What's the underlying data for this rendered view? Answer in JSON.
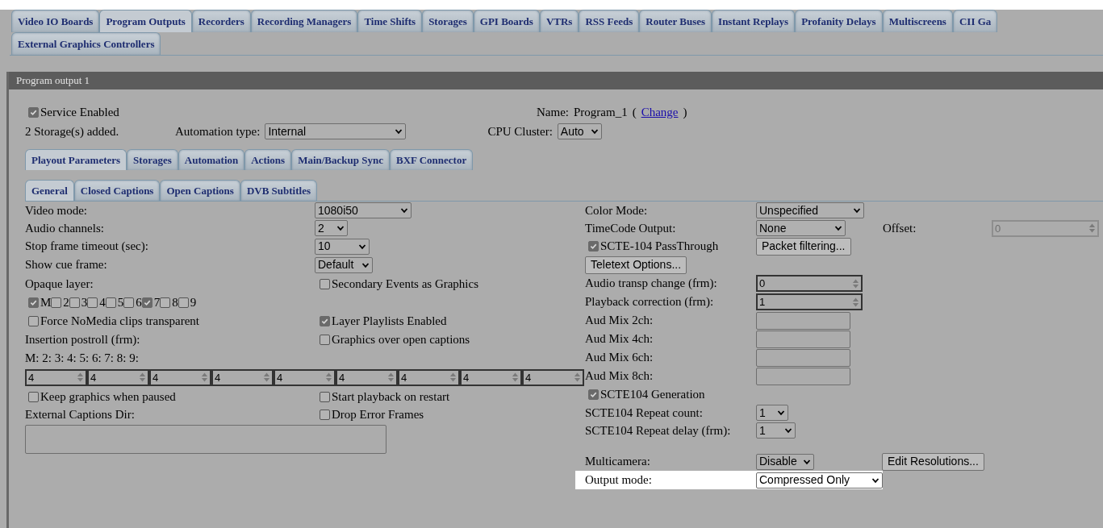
{
  "main_tabs": [
    {
      "label": "Video IO Boards",
      "selected": false
    },
    {
      "label": "Program Outputs",
      "selected": true
    },
    {
      "label": "Recorders",
      "selected": false
    },
    {
      "label": "Recording Managers",
      "selected": false
    },
    {
      "label": "Time Shifts",
      "selected": false
    },
    {
      "label": "Storages",
      "selected": false
    },
    {
      "label": "GPI Boards",
      "selected": false
    },
    {
      "label": "VTRs",
      "selected": false
    },
    {
      "label": "RSS Feeds",
      "selected": false
    },
    {
      "label": "Router Buses",
      "selected": false
    },
    {
      "label": "Instant Replays",
      "selected": false
    },
    {
      "label": "Profanity Delays",
      "selected": false
    },
    {
      "label": "Multiscreens",
      "selected": false
    },
    {
      "label": "CII Ga",
      "selected": false
    },
    {
      "label": "External Graphics Controllers",
      "selected": false
    }
  ],
  "panel": {
    "title": "Program output 1",
    "service_enabled": {
      "label": "Service Enabled",
      "checked": true
    },
    "storage_info": "2 Storage(s) added.",
    "automation_type": {
      "label": "Automation type:",
      "value": "Internal"
    },
    "name": {
      "label": "Name:",
      "value": "Program_1",
      "open": "(",
      "link": "Change",
      "close": ")"
    },
    "cpu_cluster": {
      "label": "CPU Cluster:",
      "value": "Auto"
    },
    "section_tabs": [
      {
        "label": "Playout Parameters",
        "selected": true
      },
      {
        "label": "Storages",
        "selected": false
      },
      {
        "label": "Automation",
        "selected": false
      },
      {
        "label": "Actions",
        "selected": false
      },
      {
        "label": "Main/Backup Sync",
        "selected": false
      },
      {
        "label": "BXF Connector",
        "selected": false
      }
    ],
    "sub_tabs": [
      {
        "label": "General",
        "selected": true
      },
      {
        "label": "Closed Captions",
        "selected": false
      },
      {
        "label": "Open Captions",
        "selected": false
      },
      {
        "label": "DVB Subtitles",
        "selected": false
      }
    ],
    "general": {
      "video_mode": {
        "label": "Video mode:",
        "value": "1080i50"
      },
      "audio_channels": {
        "label": "Audio channels:",
        "value": "2"
      },
      "stop_frame_timeout": {
        "label": "Stop frame timeout (sec):",
        "value": "10"
      },
      "show_cue_frame": {
        "label": "Show cue frame:",
        "value": "Default"
      },
      "opaque_layer": {
        "label": "Opaque layer:",
        "layers": [
          {
            "label": "M",
            "checked": true
          },
          {
            "label": "2",
            "checked": false
          },
          {
            "label": "3",
            "checked": false
          },
          {
            "label": "4",
            "checked": false
          },
          {
            "label": "5",
            "checked": false
          },
          {
            "label": "6",
            "checked": false
          },
          {
            "label": "7",
            "checked": true
          },
          {
            "label": "8",
            "checked": false
          },
          {
            "label": "9",
            "checked": false
          }
        ]
      },
      "secondary_events": {
        "label": "Secondary Events as Graphics",
        "checked": false
      },
      "force_nomedia": {
        "label": "Force NoMedia clips transparent",
        "checked": false
      },
      "layer_playlists": {
        "label": "Layer Playlists Enabled",
        "checked": true
      },
      "insertion_postroll": {
        "label": "Insertion postroll (frm):",
        "layer_labels": "M: 2: 3: 4: 5: 6: 7: 8: 9:",
        "values": [
          "4",
          "4",
          "4",
          "4",
          "4",
          "4",
          "4",
          "4",
          "4"
        ]
      },
      "graphics_over_open_captions": {
        "label": "Graphics over open captions",
        "checked": false
      },
      "keep_graphics": {
        "label": "Keep graphics when paused",
        "checked": false
      },
      "start_playback": {
        "label": "Start playback on restart",
        "checked": false
      },
      "external_captions_dir": {
        "label": "External Captions Dir:"
      },
      "drop_error_frames": {
        "label": "Drop Error Frames",
        "checked": false
      }
    },
    "right_rows": [
      {
        "kind": "select",
        "label": "Color Mode:",
        "value": "Unspecified"
      },
      {
        "kind": "select",
        "label": "TimeCode Output:",
        "value": "None",
        "offset": {
          "label": "Offset:",
          "value": "0",
          "disabled": true
        }
      },
      {
        "kind": "checkbox",
        "label": "SCTE-104 PassThrough",
        "checked": true,
        "button": "Packet filtering..."
      },
      {
        "kind": "button",
        "label": "Teletext Options..."
      },
      {
        "kind": "spin",
        "label": "Audio transp change (frm):",
        "value": "0"
      },
      {
        "kind": "spin",
        "label": "Playback correction (frm):",
        "value": "1"
      },
      {
        "kind": "text",
        "label": "Aud Mix 2ch:"
      },
      {
        "kind": "text",
        "label": "Aud Mix 4ch:"
      },
      {
        "kind": "text",
        "label": "Aud Mix 6ch:"
      },
      {
        "kind": "text",
        "label": "Aud Mix 8ch:"
      },
      {
        "kind": "checkbox",
        "label": "SCTE104 Generation",
        "checked": true
      },
      {
        "kind": "select",
        "label": "SCTE104 Repeat count:",
        "value": "1"
      },
      {
        "kind": "select",
        "label": "SCTE104 Repeat delay (frm):",
        "value": "1"
      }
    ],
    "bottom_rows": [
      {
        "label": "Multicamera:",
        "value": "Disable",
        "button": "Edit Resolutions...",
        "highlighted": false
      },
      {
        "label": "Output mode:",
        "value": "Compressed Only",
        "highlighted": true
      }
    ]
  }
}
